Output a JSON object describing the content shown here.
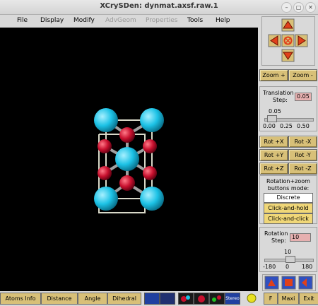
{
  "window": {
    "title": "XCrySDen: dynmat.axsf.raw.1"
  },
  "menu": [
    "File",
    "Display",
    "Modify",
    "AdvGeom",
    "Properties",
    "Tools",
    "Help"
  ],
  "panel": {
    "zoom_in": "Zoom +",
    "zoom_out": "Zoom -",
    "translation_label": "Translation",
    "step_label": "Step:",
    "translation_step": "0.05",
    "translation_slider_value": "0.05",
    "translation_ticks": [
      "0.00",
      "0.25",
      "0.50"
    ],
    "rot_buttons": [
      "Rot +X",
      "Rot -X",
      "Rot +Y",
      "Rot -Y",
      "Rot +Z",
      "Rot -Z"
    ],
    "mode_title_1": "Rotation+zoom",
    "mode_title_2": "buttons mode:",
    "mode_discrete": "Discrete",
    "mode_click_hold": "Click-and-hold",
    "mode_click_click": "Click-and-click",
    "rotation_label": "Rotation",
    "rotation_step_label": "Step:",
    "rotation_step": "10",
    "rotation_slider_value": "10",
    "rotation_ticks": [
      "-180",
      "0",
      "180"
    ]
  },
  "bottom": {
    "atoms_info": "Atoms Info",
    "distance": "Distance",
    "angle": "Angle",
    "dihedral": "Dihedral",
    "stereo": "Stereo",
    "f": "F",
    "maxi": "Maxi",
    "exit": "Exit"
  },
  "colors": {
    "atom_ti": "#1cc2e6",
    "atom_o": "#c8102e",
    "bond": "#d8d8c8",
    "button": "#d8c078",
    "arrow": "#e0401a"
  }
}
